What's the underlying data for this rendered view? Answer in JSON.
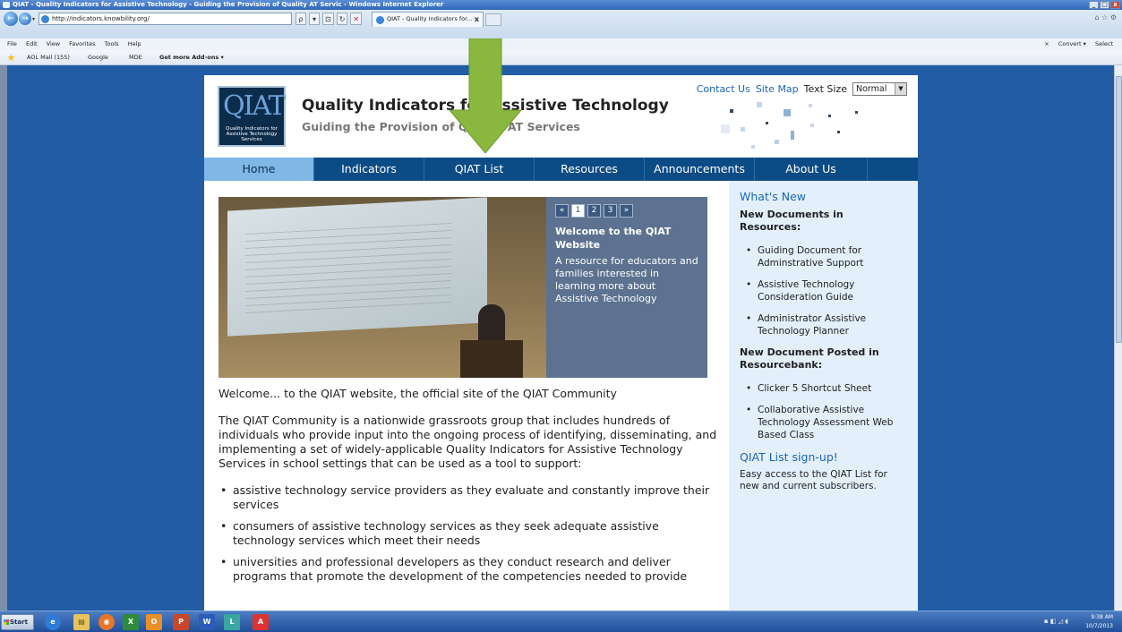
{
  "window": {
    "title": "QIAT - Quality Indicators for Assistive Technology - Guiding the Provision of Quality AT Servic - Windows Internet Explorer",
    "controls": [
      "_",
      "□",
      "x"
    ]
  },
  "browser": {
    "back_glyph": "←",
    "forward_glyph": "→",
    "address": "http://indicators.knowbility.org/",
    "addr_tools": [
      "ρ",
      "▾",
      "⊡",
      "↻",
      "✕"
    ],
    "tab_title": "QIAT - Quality Indicators for...",
    "tab_close": "x",
    "chrome_right": "⌂ ☆ ⚙",
    "menu": [
      "File",
      "Edit",
      "View",
      "Favorites",
      "Tools",
      "Help"
    ],
    "toolbar_right": [
      "×",
      "Convert ▾",
      "Select"
    ],
    "favorites": [
      "AOL Mail (155)",
      "Google",
      "MDE",
      "Get more Add-ons ▾"
    ]
  },
  "site": {
    "logo_mark": "QIAT",
    "logo_text": "Quality Indicators for Assistive Technology Services",
    "title": "Quality Indicators for Assistive Technology",
    "tagline": "Guiding the Provision of Quality AT Services",
    "util": {
      "contact": "Contact Us",
      "sitemap": "Site Map",
      "text_size_label": "Text Size",
      "text_size_value": "Normal"
    },
    "nav": [
      "Home",
      "Indicators",
      "QIAT List",
      "Resources",
      "Announcements",
      "About Us"
    ],
    "slider": {
      "pager": [
        "«",
        "1",
        "2",
        "3",
        "»"
      ],
      "title": "Welcome to the QIAT Website",
      "text": "A resource for educators and families interested in learning more about Assistive Technology"
    },
    "content": {
      "welcome": "Welcome... to the QIAT website, the official site of the QIAT Community",
      "intro": "The QIAT Community is a nationwide grassroots group that includes hundreds of individuals who provide input into the ongoing process of identifying, disseminating, and implementing a set of widely-applicable Quality Indicators for Assistive Technology Services in school settings that can be used as a tool to support:",
      "bullets": [
        "assistive technology service providers as they evaluate and constantly improve their services",
        "consumers of assistive technology services as they seek adequate assistive technology services which meet their needs",
        "universities and professional developers as they conduct research and deliver programs that promote the development of the competencies needed to provide"
      ]
    },
    "sidebar": {
      "whats_new": "What's New",
      "docs_heading": "New Documents in Resources:",
      "docs": [
        "Guiding Document for Adminstrative Support",
        "Assistive Technology Consideration Guide",
        "Administrator Assistive Technology Planner"
      ],
      "bank_heading": "New Document Posted in Resourcebank:",
      "bank": [
        "Clicker 5 Shortcut Sheet",
        "Collaborative Assistive Technology Assessment Web Based Class"
      ],
      "signup_heading": "QIAT List sign-up!",
      "signup_text": "Easy access to the QIAT List for new and current subscribers."
    }
  },
  "taskbar": {
    "start": "Start",
    "apps": [
      "e",
      "▤",
      "◉",
      "X",
      "O",
      "P",
      "W",
      "L",
      "A"
    ],
    "tray_icons": "▪ ◧ ◿ ◖",
    "time": "9:38 AM",
    "date": "10/7/2013"
  },
  "colors": {
    "nav_bg": "#0c4c86",
    "nav_active": "#7fb7e6",
    "sidebar_bg": "#e3effb",
    "link": "#1a67b6",
    "desktop": "#215ca4",
    "arrow": "#8ab83e"
  }
}
